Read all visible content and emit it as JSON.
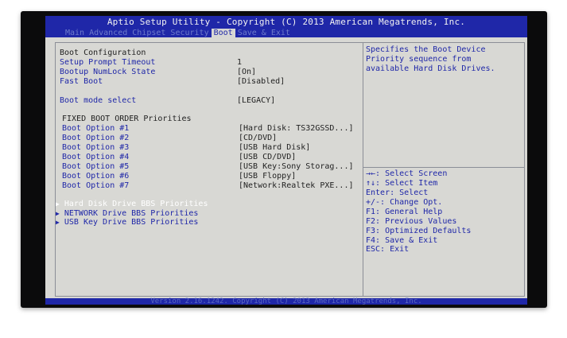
{
  "title": "Aptio Setup Utility - Copyright (C) 2013 American Megatrends, Inc.",
  "tabs": [
    "Main",
    "Advanced",
    "Chipset",
    "Security",
    "Boot",
    "Save & Exit"
  ],
  "active_tab": "Boot",
  "boot_config": {
    "header": "Boot Configuration",
    "setup_prompt_timeout": {
      "label": "Setup Prompt Timeout",
      "value": "1"
    },
    "numlock": {
      "label": "Bootup NumLock State",
      "value": "[On]"
    },
    "fast_boot": {
      "label": "Fast Boot",
      "value": "[Disabled]"
    },
    "boot_mode": {
      "label": "Boot mode select",
      "value": "[LEGACY]"
    }
  },
  "fixed_boot_order": {
    "header": "FIXED BOOT ORDER Priorities",
    "options": [
      {
        "label": "Boot Option #1",
        "value": "[Hard Disk: TS32GSSD...]"
      },
      {
        "label": "Boot Option #2",
        "value": "[CD/DVD]"
      },
      {
        "label": "Boot Option #3",
        "value": "[USB Hard Disk]"
      },
      {
        "label": "Boot Option #4",
        "value": "[USB CD/DVD]"
      },
      {
        "label": "Boot Option #5",
        "value": "[USB Key:Sony Storag...]"
      },
      {
        "label": "Boot Option #6",
        "value": "[USB Floppy]"
      },
      {
        "label": "Boot Option #7",
        "value": "[Network:Realtek PXE...]"
      }
    ]
  },
  "submenus": [
    {
      "label": "Hard Disk Drive BBS Priorities"
    },
    {
      "label": "NETWORK Drive BBS Priorities"
    },
    {
      "label": "USB Key Drive BBS Priorities"
    }
  ],
  "help_text": [
    "Specifies the Boot Device",
    "Priority sequence from",
    "available Hard Disk Drives."
  ],
  "key_help": [
    "→←: Select Screen",
    "↑↓: Select Item",
    "Enter: Select",
    "+/-: Change Opt.",
    "F1: General Help",
    "F2: Previous Values",
    "F3: Optimized Defaults",
    "F4: Save & Exit",
    "ESC: Exit"
  ],
  "footer": "Version 2.16.1242. Copyright (C) 2013 American Megatrends, Inc.",
  "colors": {
    "title_bar": "#1f27a8",
    "screen": "#d8d8d4",
    "text": "#1f27a8"
  }
}
